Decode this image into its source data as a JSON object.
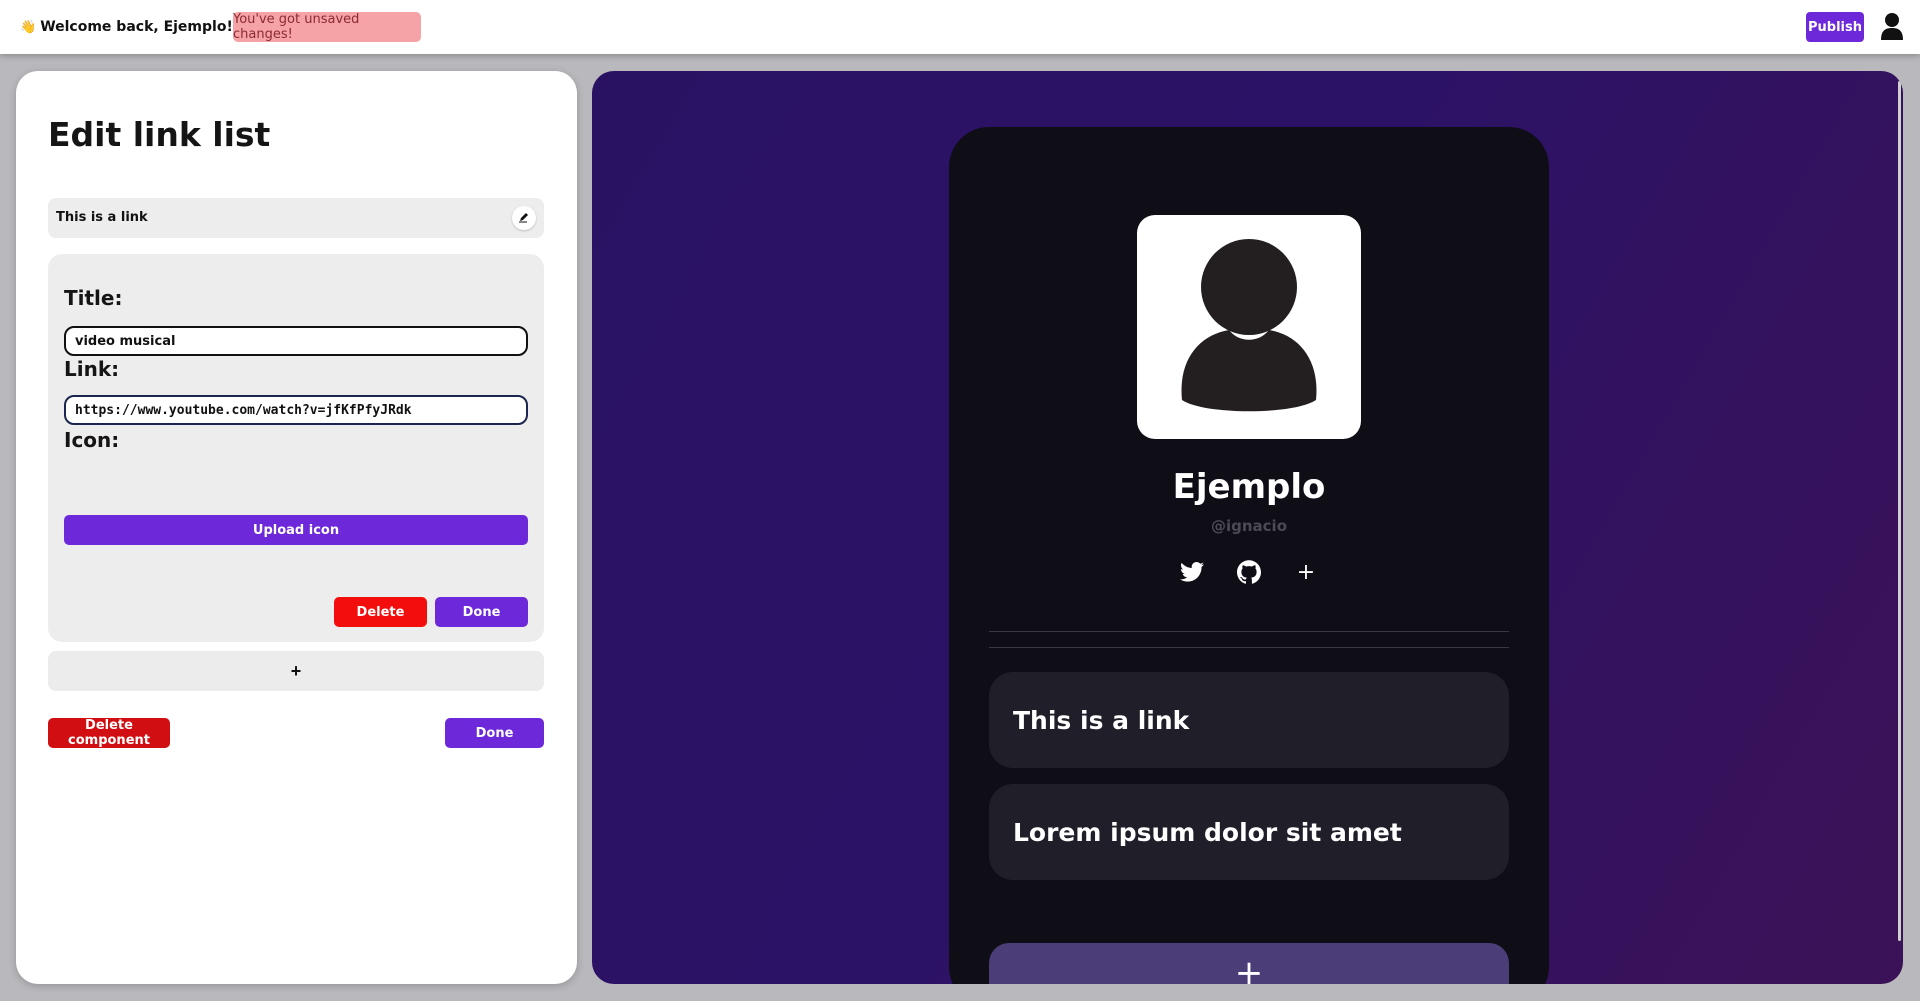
{
  "topbar": {
    "welcome_emoji": "👋",
    "welcome_text": "Welcome back, Ejemplo!",
    "unsaved_notice": "You've got unsaved changes!",
    "publish_label": "Publish",
    "user_icon": "user-icon"
  },
  "editor_panel": {
    "title": "Edit link list",
    "link_item_label": "This is a link",
    "title_label": "Title:",
    "title_value": "video musical",
    "link_label": "Link:",
    "link_value": "https://www.youtube.com/watch?v=jfKfPfyJRdk",
    "icon_label": "Icon:",
    "upload_label": "Upload icon",
    "delete_label": "Delete",
    "done_label": "Done",
    "add_label": "+",
    "delete_component_label": "Delete component",
    "done_component_label": "Done"
  },
  "preview": {
    "name": "Ejemplo",
    "handle": "@ignacio",
    "socials": [
      "twitter-icon",
      "github-icon"
    ],
    "add_social_label": "+",
    "links": [
      "This is a link",
      "Lorem ipsum dolor sit amet"
    ],
    "add_link_label": "+"
  },
  "colors": {
    "accent": "#6c28d9",
    "danger": "#f40d0d",
    "unsaved_bg": "#f5a3a7",
    "phone_bg": "#0f0e16",
    "preview_bg": "#2c1266"
  }
}
